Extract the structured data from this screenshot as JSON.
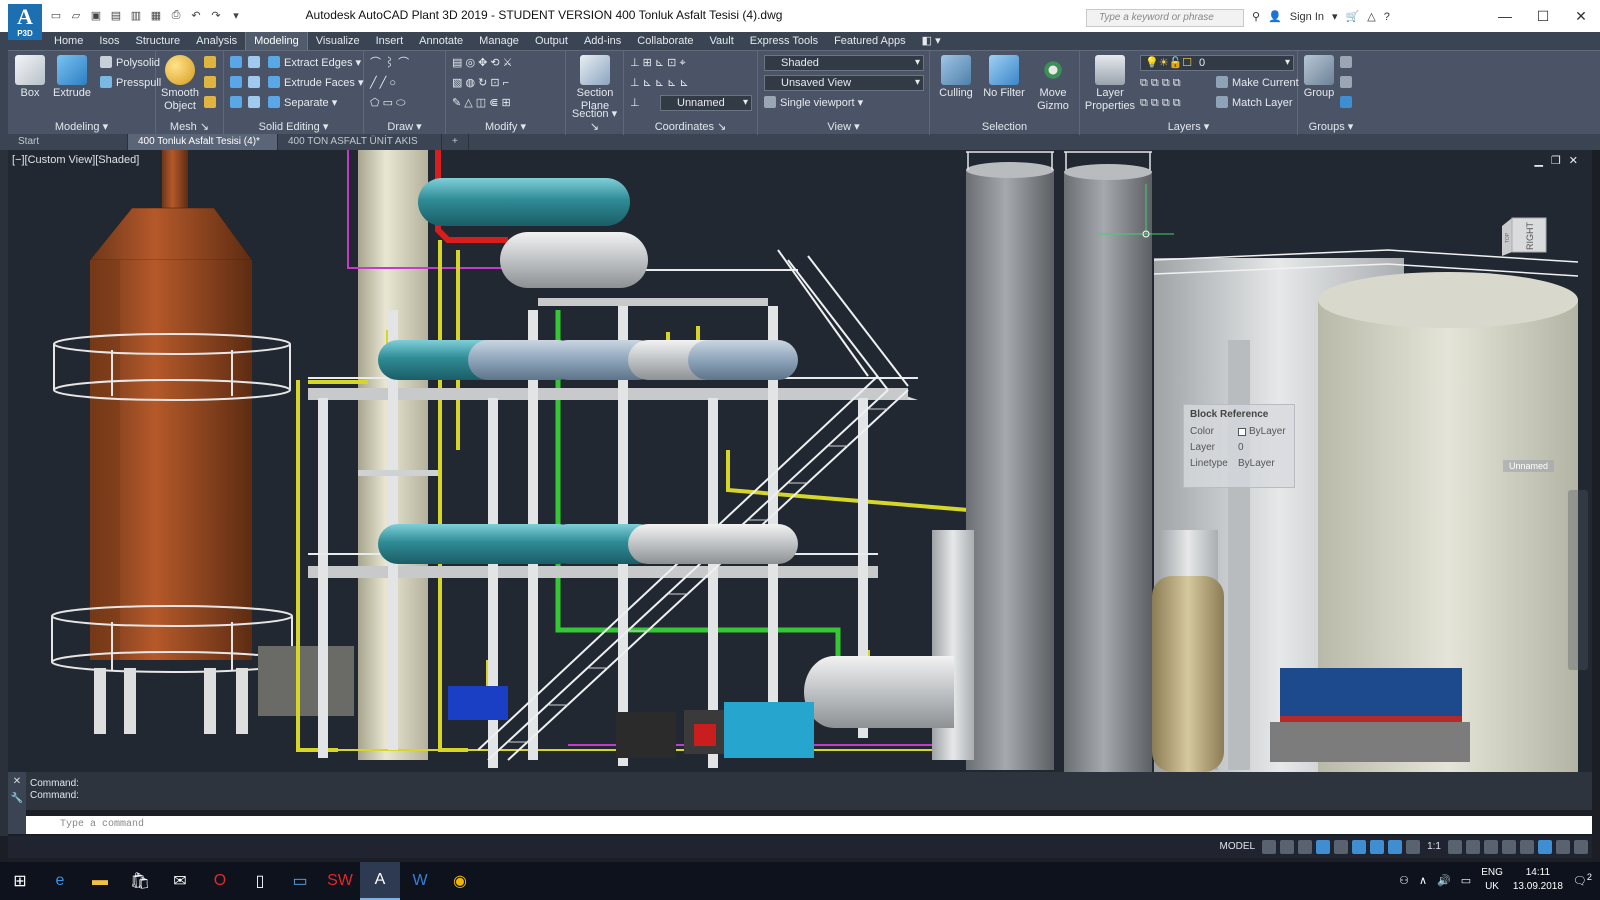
{
  "app": {
    "logo_text": "A",
    "logo_sub": "P3D",
    "title": "Autodesk AutoCAD Plant 3D 2019 - STUDENT VERSION     400 Tonluk Asfalt Tesisi (4).dwg",
    "search_placeholder": "Type a keyword or phrase",
    "sign_in": "Sign In",
    "window_controls": [
      "minimize-icon",
      "maximize-icon",
      "close-icon"
    ]
  },
  "ribbon_tabs": [
    "Home",
    "Isos",
    "Structure",
    "Analysis",
    "Modeling",
    "Visualize",
    "Insert",
    "Annotate",
    "Manage",
    "Output",
    "Add-ins",
    "Collaborate",
    "Vault",
    "Express Tools",
    "Featured Apps"
  ],
  "active_tab": "Modeling",
  "panels": {
    "modeling": {
      "label": "Modeling",
      "box": "Box",
      "extrude": "Extrude",
      "polysolid": "Polysolid",
      "presspull": "Presspull"
    },
    "mesh": {
      "label": "Mesh",
      "smooth1": "Smooth",
      "smooth2": "Object"
    },
    "solid_editing": {
      "label": "Solid Editing",
      "extract_edges": "Extract Edges",
      "extrude_faces": "Extrude Faces",
      "separate": "Separate"
    },
    "draw": {
      "label": "Draw"
    },
    "modify": {
      "label": "Modify"
    },
    "section": {
      "label": "Section",
      "section_plane1": "Section",
      "section_plane2": "Plane"
    },
    "coordinates": {
      "label": "Coordinates",
      "ucs_combo": "Unnamed"
    },
    "view": {
      "label": "View",
      "visual_style": "Shaded",
      "view_combo": "Unsaved View",
      "viewport": "Single viewport"
    },
    "selection": {
      "label": "Selection",
      "culling": "Culling",
      "no_filter": "No Filter",
      "move_gizmo1": "Move",
      "move_gizmo2": "Gizmo"
    },
    "layers": {
      "label": "Layers",
      "layer_props1": "Layer",
      "layer_props2": "Properties",
      "layer_combo": "0",
      "make_current": "Make Current",
      "match_layer": "Match Layer"
    },
    "groups": {
      "label": "Groups",
      "group": "Group"
    }
  },
  "doc_tabs": [
    "Start",
    "400 Tonluk Asfalt Tesisi (4)*",
    "400 TON ASFALT ÜNİT AKIS -1*"
  ],
  "active_doc": "400 Tonluk Asfalt Tesisi (4)*",
  "viewport": {
    "label": "[−][Custom View][Shaded]",
    "viewcube_face": "RIGHT",
    "viewcube_top": "TOP",
    "unnamed_badge": "Unnamed"
  },
  "tooltip": {
    "heading": "Block Reference",
    "rows": [
      {
        "k": "Color",
        "v": "ByLayer"
      },
      {
        "k": "Layer",
        "v": "0"
      },
      {
        "k": "Linetype",
        "v": "ByLayer"
      }
    ]
  },
  "command": {
    "history": [
      "Command:",
      "Command:"
    ],
    "placeholder": "Type a command"
  },
  "statusbar": {
    "model": "MODEL",
    "scale": "1:1"
  },
  "taskbar": {
    "apps": [
      "windows-start-icon",
      "edge-icon",
      "file-explorer-icon",
      "store-icon",
      "mail-icon",
      "opera-icon",
      "file-icon",
      "screen-icon",
      "solidworks-icon",
      "autocad-icon",
      "word-icon",
      "chrome-icon"
    ],
    "active_app": "autocad-icon",
    "lang1": "ENG",
    "lang2": "UK",
    "time": "14:11",
    "date": "13.09.2018",
    "notification_count": "2"
  },
  "colors": {
    "chrome": "#3b4453",
    "ribbon": "#4a5466",
    "viewport_bg": "#222831",
    "accent": "#3f8ed1"
  }
}
